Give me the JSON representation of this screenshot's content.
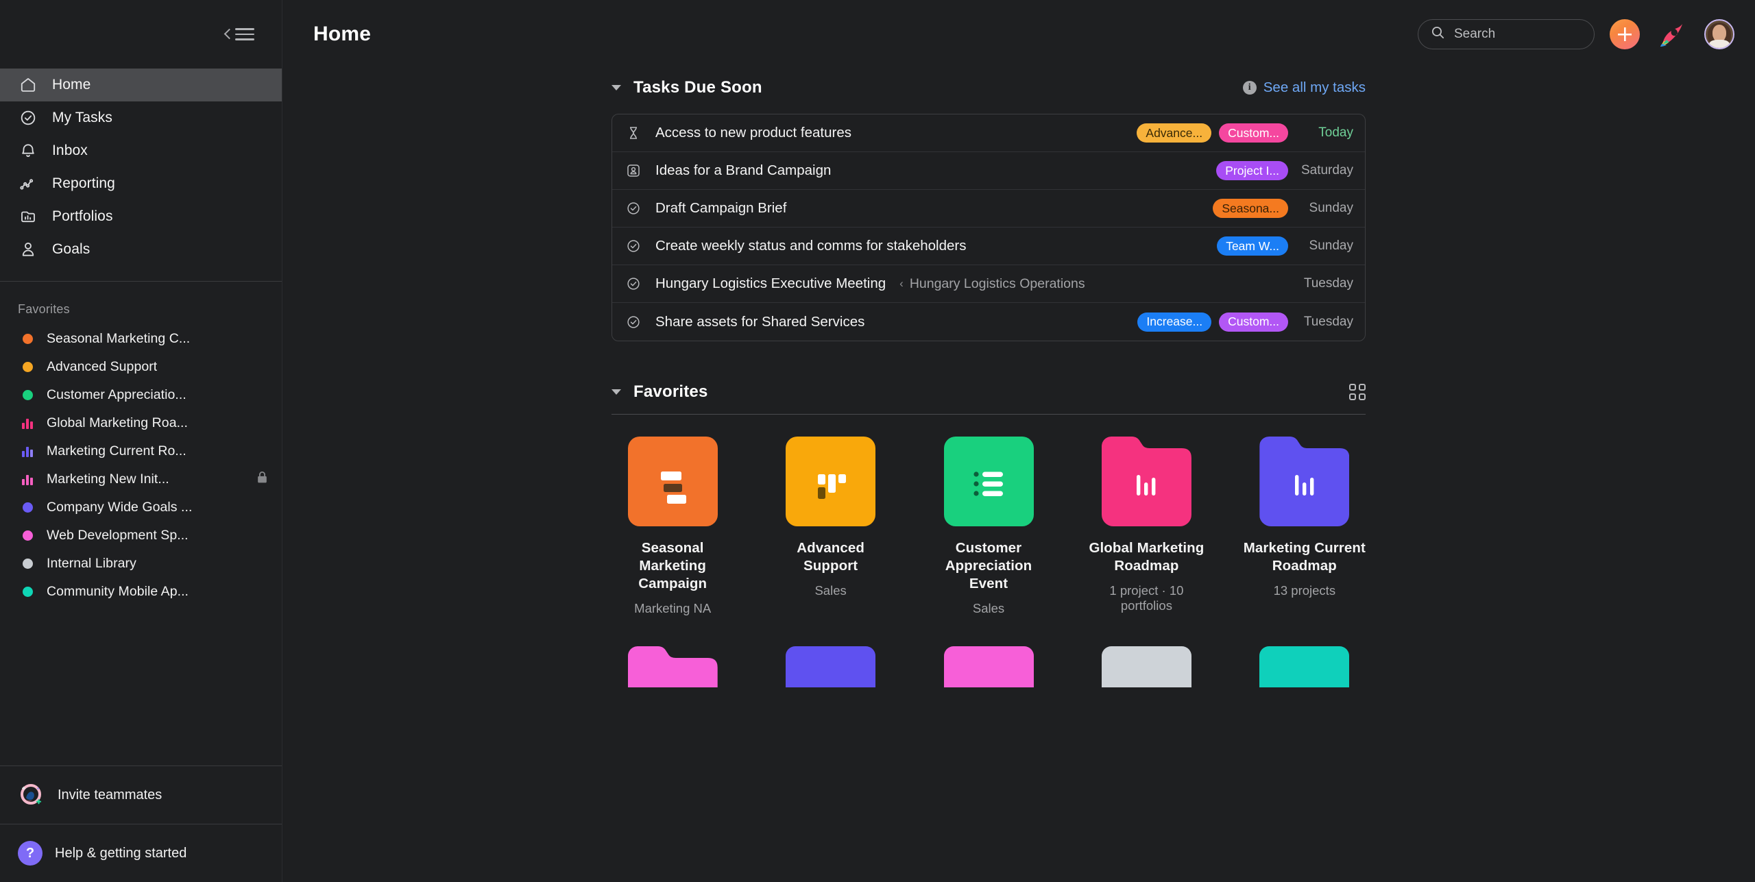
{
  "sidebar": {
    "collapse_icon": "sidebar-collapse-icon",
    "nav": [
      {
        "label": "Home",
        "icon": "home-icon",
        "active": true
      },
      {
        "label": "My Tasks",
        "icon": "check-circle-icon",
        "active": false
      },
      {
        "label": "Inbox",
        "icon": "bell-icon",
        "active": false
      },
      {
        "label": "Reporting",
        "icon": "line-chart-icon",
        "active": false
      },
      {
        "label": "Portfolios",
        "icon": "portfolio-folder-icon",
        "active": false
      },
      {
        "label": "Goals",
        "icon": "goal-person-icon",
        "active": false
      }
    ],
    "favorites_heading": "Favorites",
    "favorites": [
      {
        "label": "Seasonal Marketing C...",
        "icon": "dot-icon",
        "color": "#f2722b"
      },
      {
        "label": "Advanced Support",
        "icon": "dot-icon",
        "color": "#f5a623"
      },
      {
        "label": "Customer Appreciatio...",
        "icon": "dot-icon",
        "color": "#19d07e"
      },
      {
        "label": "Global Marketing Roa...",
        "icon": "bars-icon",
        "color": "#f5327f"
      },
      {
        "label": "Marketing Current Ro...",
        "icon": "bars-icon",
        "color": "#6a5bf5"
      },
      {
        "label": "Marketing New Init...",
        "icon": "bars-icon",
        "color": "#f55ec0",
        "locked": true,
        "lock_icon": "lock-icon"
      },
      {
        "label": "Company Wide Goals ...",
        "icon": "dot-icon",
        "color": "#6a5bf5"
      },
      {
        "label": "Web Development Sp...",
        "icon": "dot-icon",
        "color": "#f75fd8"
      },
      {
        "label": "Internal Library",
        "icon": "dot-icon",
        "color": "#c9cdd2"
      },
      {
        "label": "Community Mobile Ap...",
        "icon": "dot-icon",
        "color": "#0fd6b6"
      }
    ],
    "invite": {
      "label": "Invite teammates",
      "icon": "invite-teammates-icon"
    },
    "help": {
      "label": "Help & getting started",
      "icon": "question-mark-icon"
    }
  },
  "header": {
    "title": "Home",
    "search": {
      "placeholder": "Search",
      "icon": "search-icon"
    },
    "create_button": {
      "label": "+",
      "icon": "plus-icon",
      "color": "#f7863f"
    },
    "bird_icon": "asana-bird-icon",
    "avatar": "user-avatar"
  },
  "tasks_section": {
    "title": "Tasks Due Soon",
    "caret_icon": "caret-down-icon",
    "see_all": {
      "label": "See all my tasks",
      "icon": "info-circle-icon",
      "color": "#6fa8f5"
    },
    "rows": [
      {
        "name": "Access to new product features",
        "icon": "hourglass-icon",
        "project": "",
        "tags": [
          {
            "label": "Advance...",
            "bg": "#f7b23b",
            "fg": "#3a2a06"
          },
          {
            "label": "Custom...",
            "bg": "#f5479f",
            "fg": "#ffffff"
          }
        ],
        "due": "Today",
        "due_today": true
      },
      {
        "name": "Ideas for a Brand Campaign",
        "icon": "approval-stamp-icon",
        "project": "",
        "tags": [
          {
            "label": "Project I...",
            "bg": "#a84df5",
            "fg": "#ffffff"
          }
        ],
        "due": "Saturday",
        "due_today": false
      },
      {
        "name": "Draft Campaign Brief",
        "icon": "check-circle-icon",
        "project": "",
        "tags": [
          {
            "label": "Seasona...",
            "bg": "#f47a20",
            "fg": "#3a2106"
          }
        ],
        "due": "Sunday",
        "due_today": false
      },
      {
        "name": "Create weekly status and comms for stakeholders",
        "icon": "check-circle-icon",
        "project": "",
        "tags": [
          {
            "label": "Team W...",
            "bg": "#1b7ef5",
            "fg": "#ffffff"
          }
        ],
        "due": "Sunday",
        "due_today": false
      },
      {
        "name": "Hungary Logistics Executive Meeting",
        "icon": "check-circle-icon",
        "project": "Hungary Logistics Operations",
        "tags": [],
        "due": "Tuesday",
        "due_today": false
      },
      {
        "name": "Share assets for Shared Services",
        "icon": "check-circle-icon",
        "project": "",
        "tags": [
          {
            "label": "Increase...",
            "bg": "#1b7ef5",
            "fg": "#ffffff"
          },
          {
            "label": "Custom...",
            "bg": "#b257f5",
            "fg": "#ffffff"
          }
        ],
        "due": "Tuesday",
        "due_today": false
      }
    ]
  },
  "favorites_section": {
    "title": "Favorites",
    "caret_icon": "caret-down-icon",
    "grid_toggle_icon": "grid-view-icon",
    "cards": [
      {
        "title": "Seasonal Marketing Campaign",
        "subtitle": "Marketing NA",
        "color": "#f2722b",
        "shape": "square",
        "glyph": "board-icon"
      },
      {
        "title": "Advanced Support",
        "subtitle": "Sales",
        "color": "#f9a80b",
        "shape": "square",
        "glyph": "kanban-icon"
      },
      {
        "title": "Customer Appreciation Event",
        "subtitle": "Sales",
        "color": "#19d07e",
        "shape": "square",
        "glyph": "list-icon"
      },
      {
        "title": "Global Marketing Roadmap",
        "subtitle": "1 project · 10 portfolios",
        "color": "#f5327f",
        "shape": "folder",
        "glyph": "bar-chart-icon"
      },
      {
        "title": "Marketing Current Roadmap",
        "subtitle": "13 projects",
        "color": "#5f51f0",
        "shape": "folder",
        "glyph": "bar-chart-icon"
      }
    ],
    "cards_row2": [
      {
        "color": "#f75fd8",
        "shape": "folder"
      },
      {
        "color": "#5f51f0",
        "shape": "square"
      },
      {
        "color": "#f75fd8",
        "shape": "square"
      },
      {
        "color": "#ced3d8",
        "shape": "square"
      },
      {
        "color": "#0fd0bb",
        "shape": "square"
      }
    ]
  }
}
